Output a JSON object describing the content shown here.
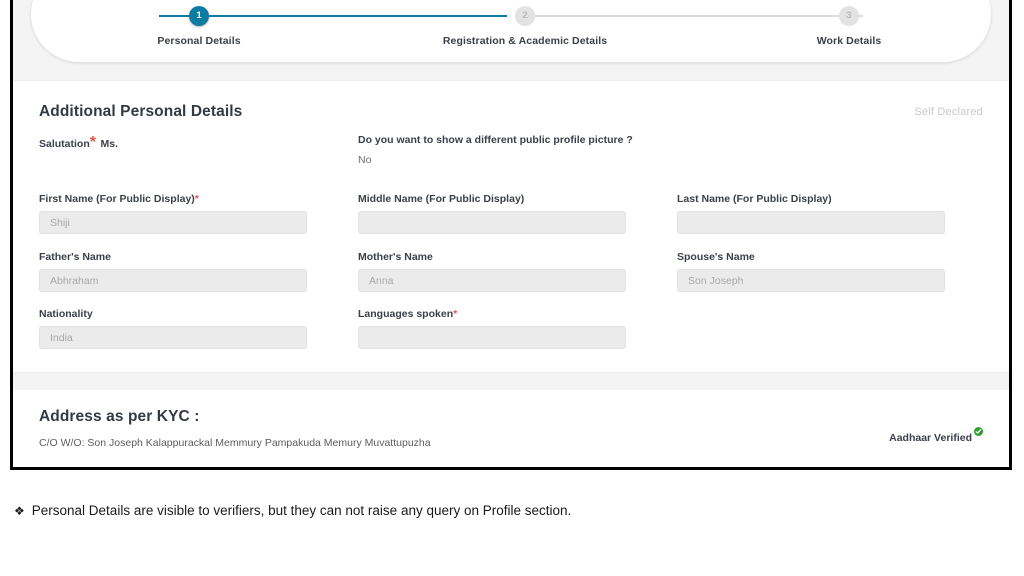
{
  "stepper": {
    "steps": [
      {
        "number": "1",
        "label": "Personal Details",
        "state": "active"
      },
      {
        "number": "2",
        "label": "Registration & Academic Details",
        "state": "inactive"
      },
      {
        "number": "3",
        "label": "Work Details",
        "state": "inactive"
      }
    ],
    "accent_color": "#0e7ba3",
    "inactive_color": "#e3e3e3"
  },
  "personal_section": {
    "title": "Additional Personal Details",
    "self_declared_label": "Self Declared",
    "salutation": {
      "label": "Salutation",
      "required_mark": "*",
      "value": "Ms."
    },
    "profile_picture_question": {
      "label": "Do you want to show a different public profile picture ?",
      "value": "No"
    },
    "fields": [
      {
        "label": "First Name (For Public Display)",
        "required_mark": "*",
        "value": "Shiji"
      },
      {
        "label": "Middle Name (For Public Display)",
        "required_mark": "",
        "value": ""
      },
      {
        "label": "Last Name (For Public Display)",
        "required_mark": "",
        "value": ""
      },
      {
        "label": "Father's Name",
        "required_mark": "",
        "value": "Abhraham"
      },
      {
        "label": "Mother's Name",
        "required_mark": "",
        "value": "Anna"
      },
      {
        "label": "Spouse's Name",
        "required_mark": "",
        "value": "Son Joseph"
      },
      {
        "label": "Nationality",
        "required_mark": "",
        "value": "India"
      },
      {
        "label": "Languages spoken",
        "required_mark": "*",
        "value": ""
      }
    ]
  },
  "kyc_section": {
    "title": "Address as per KYC :",
    "address": "C/O W/O: Son Joseph Kalappurackal Memmury Pampakuda Memury Muvattupuzha",
    "verified_label": "Aadhaar Verified",
    "verified_icon": "green-check-icon",
    "verified_color": "#2f9e2f"
  },
  "footnote": {
    "bullet": "❯",
    "text": "Personal Details are visible to verifiers, but they can not raise any query on Profile section."
  }
}
